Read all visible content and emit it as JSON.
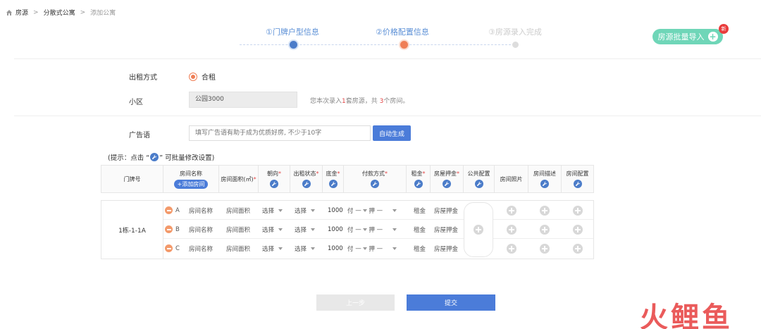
{
  "breadcrumb": {
    "home": "房源",
    "level2": "分散式公寓",
    "current": "添加公寓",
    "sep": ">"
  },
  "steps": [
    {
      "label": "①门牌户型信息"
    },
    {
      "label": "②价格配置信息"
    },
    {
      "label": "③房源录入完成"
    }
  ],
  "import_button": {
    "label": "房源批量导入",
    "badge": "新"
  },
  "form": {
    "rent_mode_label": "出租方式",
    "rent_mode_value": "合租",
    "community_label": "小区",
    "community_value": "公园3000",
    "info_prefix": "您本次录入",
    "info_count1": "1",
    "info_mid": "套房源，共",
    "info_count2": "3",
    "info_suffix": "个房间。",
    "ad_label": "广告语",
    "ad_placeholder": "填写广告语有助于成为优质好房, 不少于10字",
    "auto_generate": "自动生成"
  },
  "hint": {
    "prefix": "(提示：点击 “",
    "suffix": "” 可批量修改设置)"
  },
  "table": {
    "headers": {
      "unit_no": "门牌号",
      "room_name": "房间名称",
      "add_room": "+添加房间",
      "room_area": "房间面积(㎡)",
      "orientation": "朝向",
      "rent_status": "出租状态",
      "base_rent": "底金",
      "payment": "付款方式",
      "rent": "租金",
      "deposit": "房屋押金",
      "public": "公共配置",
      "photos": "房间照片",
      "description": "房间描述",
      "config": "房间配置",
      "required": "*"
    },
    "unit_no_value": "1栋-1-1A",
    "rows": [
      {
        "letter": "A",
        "name": "房间名称",
        "area": "房间面积",
        "orientation": "选择",
        "status": "选择",
        "base_rent": "1000",
        "pay_fu": "付",
        "pay_ya": "押",
        "dash": "—",
        "rent": "租金",
        "deposit": "房屋押金"
      },
      {
        "letter": "B",
        "name": "房间名称",
        "area": "房间面积",
        "orientation": "选择",
        "status": "选择",
        "base_rent": "1000",
        "pay_fu": "付",
        "pay_ya": "押",
        "dash": "—",
        "rent": "租金",
        "deposit": "房屋押金"
      },
      {
        "letter": "C",
        "name": "房间名称",
        "area": "房间面积",
        "orientation": "选择",
        "status": "选择",
        "base_rent": "1000",
        "pay_fu": "付",
        "pay_ya": "押",
        "dash": "—",
        "rent": "租金",
        "deposit": "房屋押金"
      }
    ]
  },
  "footer": {
    "prev": "上一步",
    "submit": "提交"
  },
  "watermark": "火鲤鱼",
  "colors": {
    "primary": "#4b7cd9",
    "accent": "#ef7e55",
    "teal": "#6fd6b8",
    "danger": "#e34848"
  }
}
